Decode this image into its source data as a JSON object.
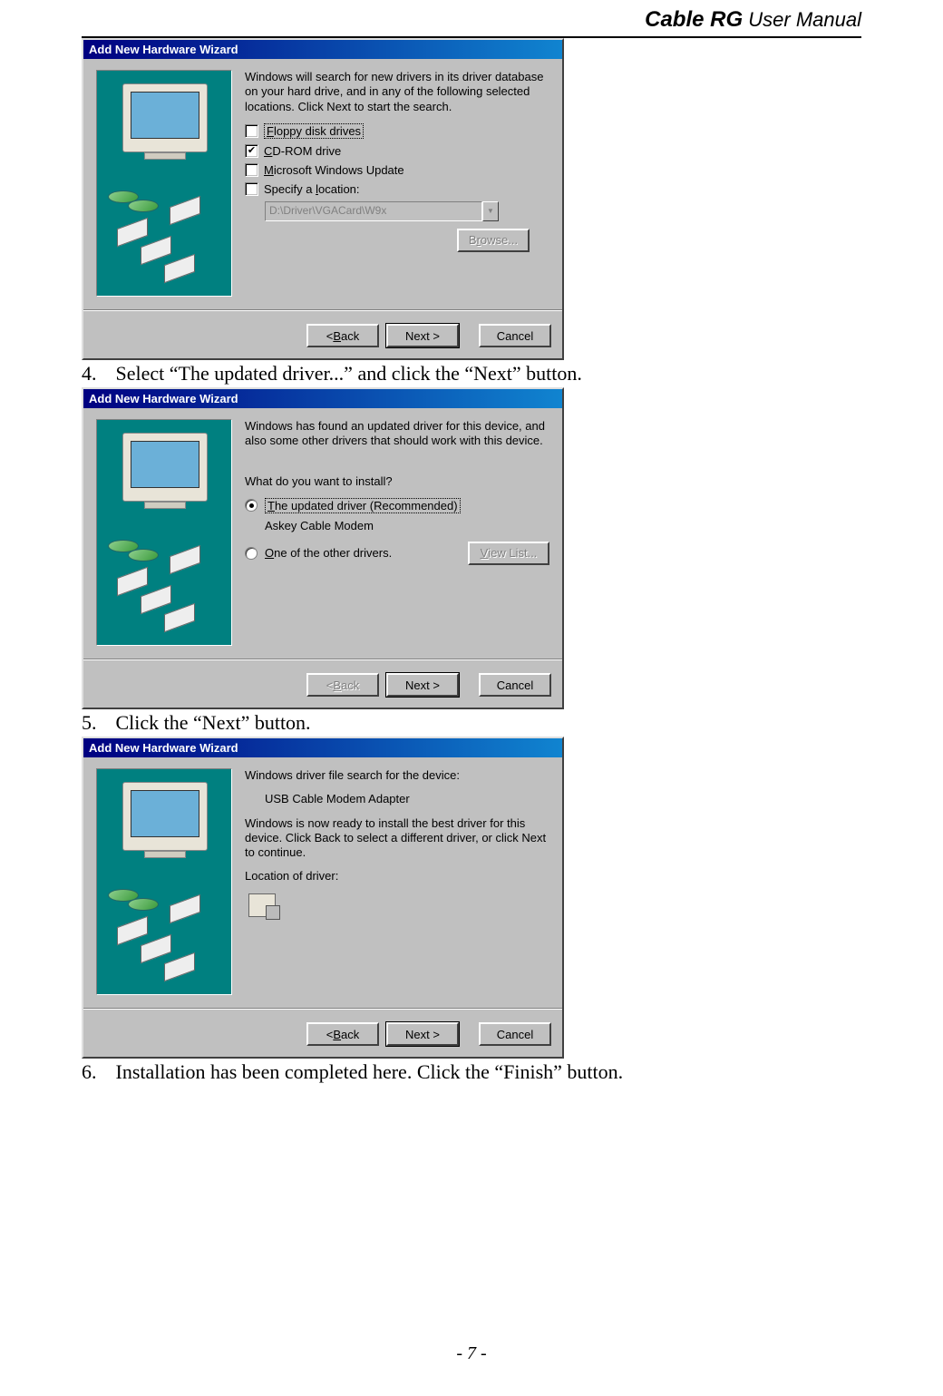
{
  "header": {
    "title_bold": "Cable RG",
    "title_rest": " User Manual"
  },
  "page_number": "- 7 -",
  "steps": {
    "s4": {
      "num": "4.",
      "text": "Select “The updated driver...” and click the “Next” button."
    },
    "s5": {
      "num": "5.",
      "text": "Click the “Next” button."
    },
    "s6": {
      "num": "6.",
      "text": "Installation has been completed here. Click the “Finish” button."
    }
  },
  "wizard1": {
    "title": "Add New Hardware Wizard",
    "intro": "Windows will search for new drivers in its driver database on your hard drive, and in any of the following selected locations. Click Next to start the search.",
    "opt_floppy": "Floppy disk drives",
    "opt_cdrom": "CD-ROM drive",
    "opt_winupdate": "Microsoft Windows Update",
    "opt_specify": "Specify a location:",
    "location_value": "D:\\Driver\\VGACard\\W9x",
    "browse": "Browse...",
    "back": "< Back",
    "next": "Next >",
    "cancel": "Cancel",
    "floppy_checked": false,
    "cdrom_checked": true,
    "winupdate_checked": false,
    "specify_checked": false
  },
  "wizard2": {
    "title": "Add New Hardware Wizard",
    "intro": "Windows has found an updated driver for this device, and also some other drivers that should work with this device.",
    "question": "What do you want to install?",
    "opt_updated": "The updated driver (Recommended)",
    "device_name": "Askey Cable Modem",
    "opt_other": "One of the other drivers.",
    "viewlist": "View List...",
    "back": "< Back",
    "next": "Next >",
    "cancel": "Cancel"
  },
  "wizard3": {
    "title": "Add New Hardware Wizard",
    "line1": "Windows driver file search for the device:",
    "device": "USB Cable Modem Adapter",
    "line2": "Windows is now ready to install the best driver for this device. Click Back to select a different driver, or click Next to continue.",
    "loc_label": "Location of driver:",
    "back": "< Back",
    "next": "Next >",
    "cancel": "Cancel"
  }
}
